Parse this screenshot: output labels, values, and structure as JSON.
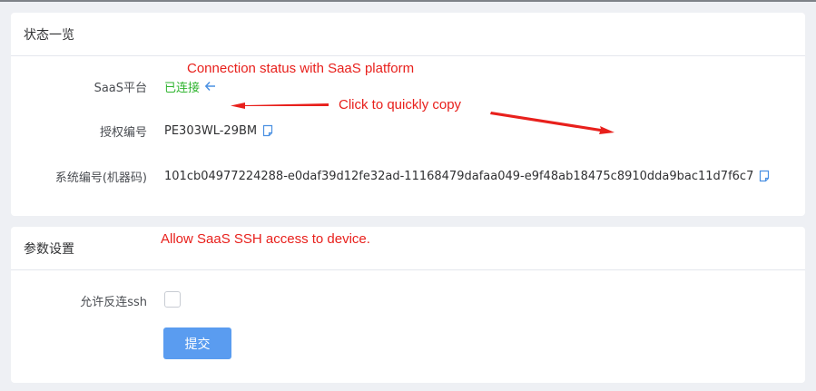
{
  "status_card": {
    "title": "状态一览",
    "saas_label": "SaaS平台",
    "saas_value": "已连接",
    "license_label": "授权编号",
    "license_value": "PE303WL-29BM",
    "system_label": "系统编号(机器码)",
    "system_value": "101cb04977224288-e0daf39d12fe32ad-11168479dafaa049-e9f48ab18475c8910dda9bac11d7f6c7"
  },
  "params_card": {
    "title": "参数设置",
    "ssh_label": "允许反连ssh",
    "ssh_checked": false,
    "submit_label": "提交"
  },
  "annotations": {
    "connection": "Connection status with SaaS platform",
    "copy": "Click to quickly copy",
    "ssh": "Allow SaaS SSH access to device."
  },
  "icons": {
    "refresh": "arrow-left-icon",
    "copy": "document-copy-icon"
  },
  "colors": {
    "connected": "#2fb42f",
    "annotation": "#e8201c",
    "primary": "#5a9cf0",
    "icon": "#4a90e2"
  }
}
